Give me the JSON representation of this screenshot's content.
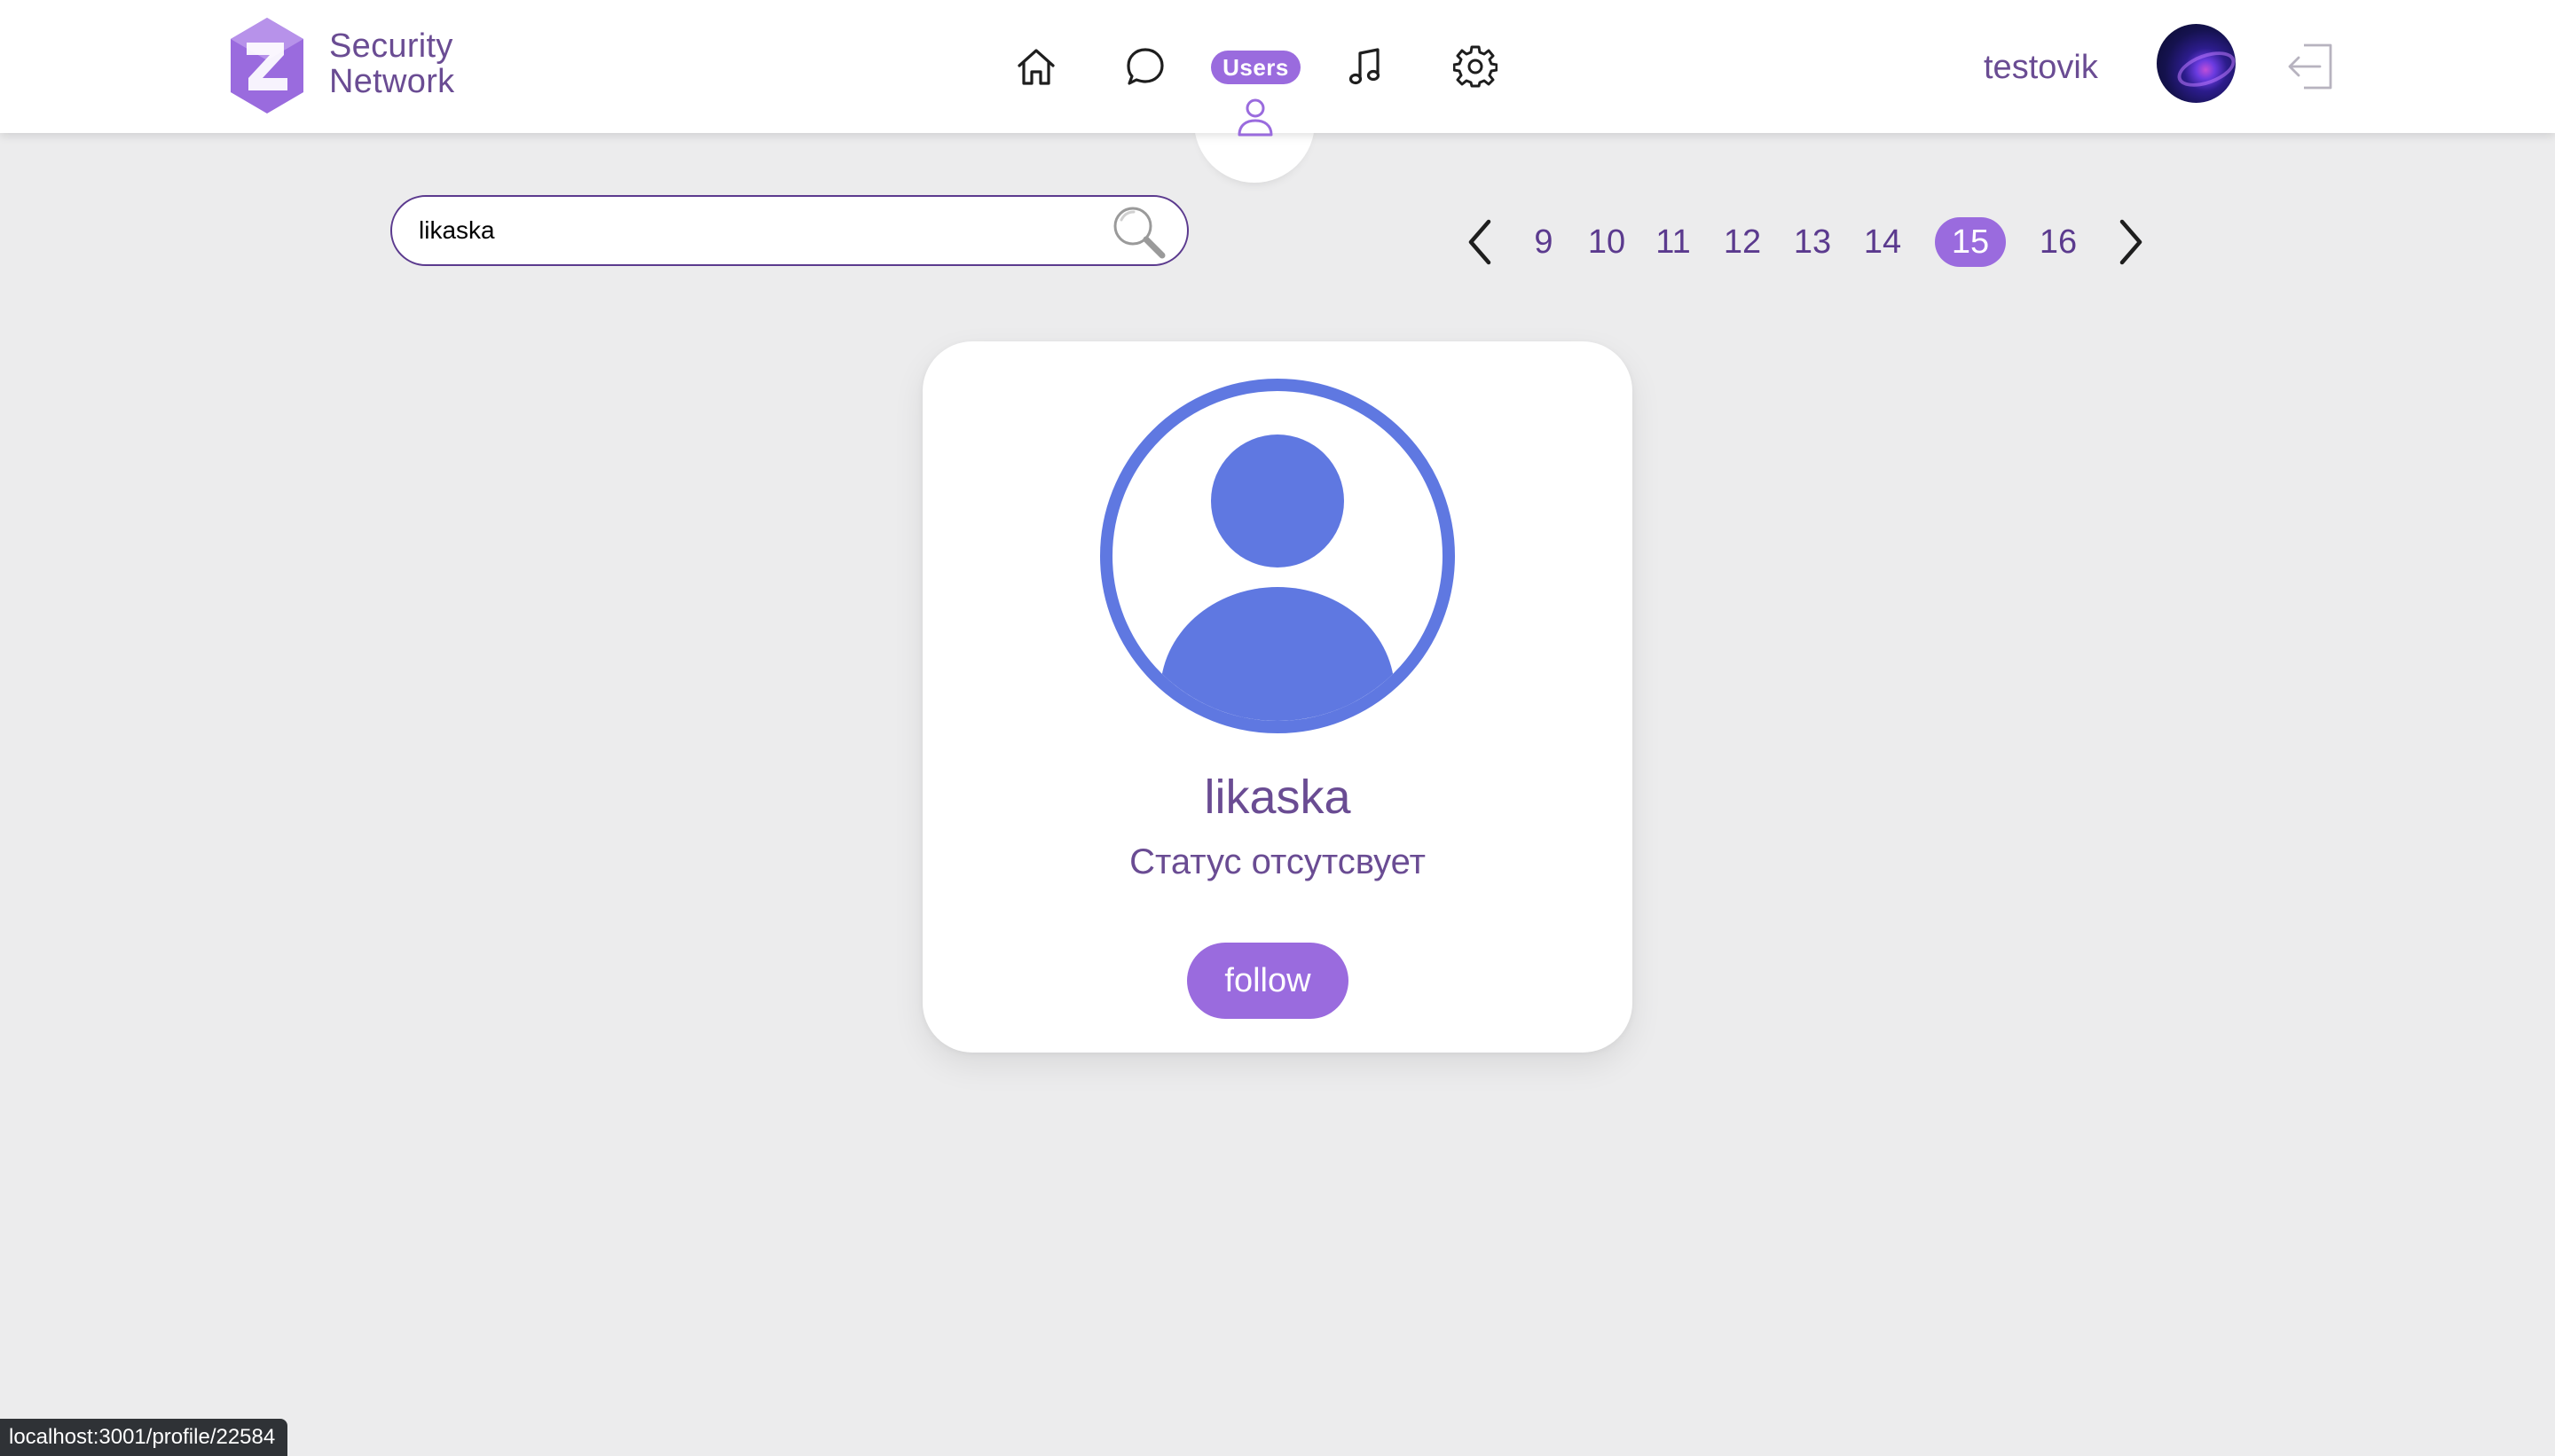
{
  "app": {
    "logo_line1": "Security",
    "logo_line2": "Network",
    "brand_color": "#9a6bde",
    "text_color": "#6a4c93"
  },
  "nav": {
    "items": [
      {
        "icon": "home-icon"
      },
      {
        "icon": "chat-icon"
      },
      {
        "icon": "users-icon",
        "label": "Users",
        "active": true
      },
      {
        "icon": "music-icon"
      },
      {
        "icon": "gear-icon"
      }
    ]
  },
  "user": {
    "name": "testovik",
    "avatar_icon": "avatar-image"
  },
  "search": {
    "value": "likaska",
    "placeholder": ""
  },
  "pagination": {
    "pages": [
      "9",
      "10",
      "11",
      "12",
      "13",
      "14",
      "15",
      "16"
    ],
    "current": "15"
  },
  "profile_card": {
    "name": "likaska",
    "status": "Статус отсутсвует",
    "follow_label": "follow",
    "avatar_color": "#5f78e1"
  },
  "status_bar": {
    "url": "localhost:3001/profile/22584"
  }
}
